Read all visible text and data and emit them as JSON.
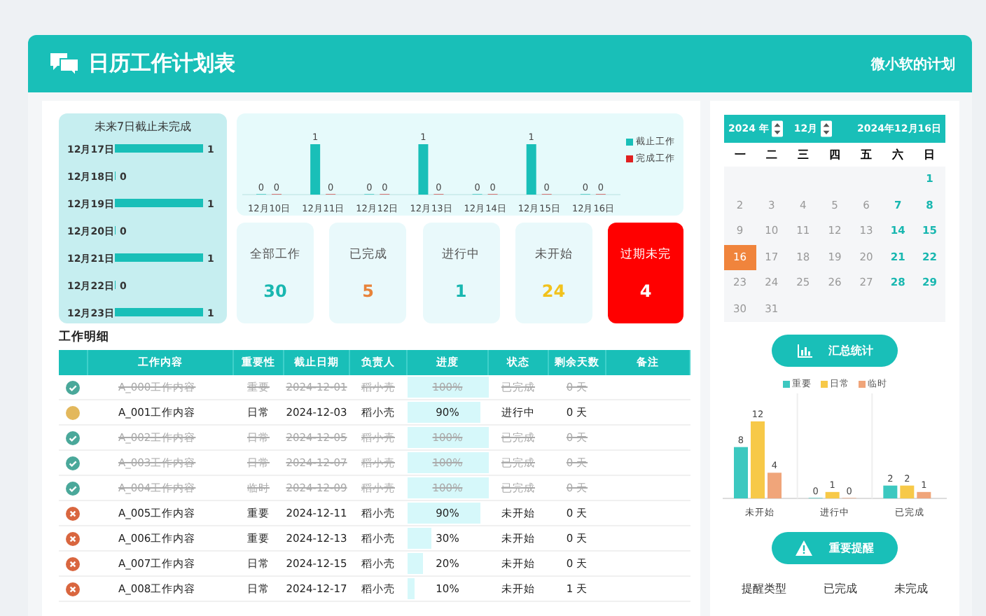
{
  "header": {
    "title": "日历工作计划表",
    "subtitle": "微小软的计划"
  },
  "upcoming": {
    "chart_data": {
      "type": "bar",
      "orientation": "horizontal",
      "title": "未来7日截止未完成",
      "categories": [
        "12月17日",
        "12月18日",
        "12月19日",
        "12月20日",
        "12月21日",
        "12月22日",
        "12月23日"
      ],
      "values": [
        1,
        0,
        1,
        0,
        1,
        0,
        1
      ],
      "data_labels": true
    }
  },
  "week_chart": {
    "chart_data": {
      "type": "bar",
      "categories": [
        "12月10日",
        "12月11日",
        "12月12日",
        "12月13日",
        "12月14日",
        "12月15日",
        "12月16日"
      ],
      "series": [
        {
          "name": "截止工作",
          "color": "#19bfb8",
          "values": [
            0,
            1,
            0,
            1,
            0,
            1,
            0
          ]
        },
        {
          "name": "完成工作",
          "color": "#e02020",
          "values": [
            0,
            0,
            0,
            0,
            0,
            0,
            0
          ]
        }
      ],
      "legend": "right",
      "data_labels": true
    }
  },
  "stats": [
    {
      "kind": "normal",
      "label": "全部工作",
      "value": "30",
      "color": "#19b7b0"
    },
    {
      "kind": "normal",
      "label": "已完成",
      "value": "5",
      "color": "#e8833a"
    },
    {
      "kind": "normal",
      "label": "进行中",
      "value": "1",
      "color": "#19b7b0"
    },
    {
      "kind": "normal",
      "label": "未开始",
      "value": "24",
      "color": "#f2c21b"
    },
    {
      "kind": "alert",
      "label": "过期未完",
      "value": "4",
      "color": "#ffffff"
    }
  ],
  "table": {
    "title": "工作明细",
    "columns": [
      "工作内容",
      "重要性",
      "截止日期",
      "负责人",
      "进度",
      "状态",
      "剩余天数",
      "备注"
    ],
    "rows": [
      {
        "kind": "done",
        "struck": true,
        "content": "A_000工作内容",
        "importance": "重要",
        "deadline": "2024-12-01",
        "owner": "稻小壳",
        "progress": "100%",
        "level": 1,
        "status": "已完成",
        "remaining": "0 天"
      },
      {
        "kind": "progress",
        "struck": false,
        "content": "A_001工作内容",
        "importance": "日常",
        "deadline": "2024-12-03",
        "owner": "稻小壳",
        "progress": "90%",
        "level": 0.9,
        "status": "进行中",
        "remaining": "0 天"
      },
      {
        "kind": "done",
        "struck": true,
        "content": "A_002工作内容",
        "importance": "日常",
        "deadline": "2024-12-05",
        "owner": "稻小壳",
        "progress": "100%",
        "level": 1,
        "status": "已完成",
        "remaining": "0 天"
      },
      {
        "kind": "done",
        "struck": true,
        "content": "A_003工作内容",
        "importance": "日常",
        "deadline": "2024-12-07",
        "owner": "稻小壳",
        "progress": "100%",
        "level": 1,
        "status": "已完成",
        "remaining": "0 天"
      },
      {
        "kind": "done",
        "struck": true,
        "content": "A_004工作内容",
        "importance": "临时",
        "deadline": "2024-12-09",
        "owner": "稻小壳",
        "progress": "100%",
        "level": 1,
        "status": "已完成",
        "remaining": "0 天"
      },
      {
        "kind": "todo",
        "struck": false,
        "content": "A_005工作内容",
        "importance": "重要",
        "deadline": "2024-12-11",
        "owner": "稻小壳",
        "progress": "90%",
        "level": 0.9,
        "status": "未开始",
        "remaining": "0 天"
      },
      {
        "kind": "todo",
        "struck": false,
        "content": "A_006工作内容",
        "importance": "重要",
        "deadline": "2024-12-13",
        "owner": "稻小壳",
        "progress": "30%",
        "level": 0.3,
        "status": "未开始",
        "remaining": "0 天"
      },
      {
        "kind": "todo",
        "struck": false,
        "content": "A_007工作内容",
        "importance": "日常",
        "deadline": "2024-12-15",
        "owner": "稻小壳",
        "progress": "20%",
        "level": 0.2,
        "status": "未开始",
        "remaining": "0 天"
      },
      {
        "kind": "todo",
        "struck": false,
        "content": "A_008工作内容",
        "importance": "日常",
        "deadline": "2024-12-17",
        "owner": "稻小壳",
        "progress": "10%",
        "level": 0.1,
        "status": "未开始",
        "remaining": "1 天"
      }
    ]
  },
  "calendar": {
    "year": "2024 年",
    "month": "12月",
    "date": "2024年12月16日",
    "weekdays": [
      "一",
      "二",
      "三",
      "四",
      "五",
      "六",
      "日"
    ],
    "days": [
      {
        "kind": "blank"
      },
      {
        "kind": "blank"
      },
      {
        "kind": "blank"
      },
      {
        "kind": "blank"
      },
      {
        "kind": "blank"
      },
      {
        "kind": "blank"
      },
      {
        "kind": "day",
        "text": "1",
        "weekend": true,
        "selected": false
      },
      {
        "kind": "day",
        "text": "2",
        "weekend": false,
        "selected": false
      },
      {
        "kind": "day",
        "text": "3",
        "weekend": false,
        "selected": false
      },
      {
        "kind": "day",
        "text": "4",
        "weekend": false,
        "selected": false
      },
      {
        "kind": "day",
        "text": "5",
        "weekend": false,
        "selected": false
      },
      {
        "kind": "day",
        "text": "6",
        "weekend": false,
        "selected": false
      },
      {
        "kind": "day",
        "text": "7",
        "weekend": true,
        "selected": false
      },
      {
        "kind": "day",
        "text": "8",
        "weekend": true,
        "selected": false
      },
      {
        "kind": "day",
        "text": "9",
        "weekend": false,
        "selected": false
      },
      {
        "kind": "day",
        "text": "10",
        "weekend": false,
        "selected": false
      },
      {
        "kind": "day",
        "text": "11",
        "weekend": false,
        "selected": false
      },
      {
        "kind": "day",
        "text": "12",
        "weekend": false,
        "selected": false
      },
      {
        "kind": "day",
        "text": "13",
        "weekend": false,
        "selected": false
      },
      {
        "kind": "day",
        "text": "14",
        "weekend": true,
        "selected": false
      },
      {
        "kind": "day",
        "text": "15",
        "weekend": true,
        "selected": false
      },
      {
        "kind": "day",
        "text": "16",
        "weekend": false,
        "selected": true
      },
      {
        "kind": "day",
        "text": "17",
        "weekend": false,
        "selected": false
      },
      {
        "kind": "day",
        "text": "18",
        "weekend": false,
        "selected": false
      },
      {
        "kind": "day",
        "text": "19",
        "weekend": false,
        "selected": false
      },
      {
        "kind": "day",
        "text": "20",
        "weekend": false,
        "selected": false
      },
      {
        "kind": "day",
        "text": "21",
        "weekend": true,
        "selected": false
      },
      {
        "kind": "day",
        "text": "22",
        "weekend": true,
        "selected": false
      },
      {
        "kind": "day",
        "text": "23",
        "weekend": false,
        "selected": false
      },
      {
        "kind": "day",
        "text": "24",
        "weekend": false,
        "selected": false
      },
      {
        "kind": "day",
        "text": "25",
        "weekend": false,
        "selected": false
      },
      {
        "kind": "day",
        "text": "26",
        "weekend": false,
        "selected": false
      },
      {
        "kind": "day",
        "text": "27",
        "weekend": false,
        "selected": false
      },
      {
        "kind": "day",
        "text": "28",
        "weekend": true,
        "selected": false
      },
      {
        "kind": "day",
        "text": "29",
        "weekend": true,
        "selected": false
      },
      {
        "kind": "day",
        "text": "30",
        "weekend": false,
        "selected": false
      },
      {
        "kind": "day",
        "text": "31",
        "weekend": false,
        "selected": false
      }
    ]
  },
  "summary_button": "汇总统计",
  "summary_chart": {
    "chart_data": {
      "type": "bar",
      "categories": [
        "未开始",
        "进行中",
        "已完成"
      ],
      "series": [
        {
          "name": "重要",
          "color": "#3cc8c0",
          "values": [
            8,
            0,
            2
          ]
        },
        {
          "name": "日常",
          "color": "#f7c948",
          "values": [
            12,
            1,
            2
          ]
        },
        {
          "name": "临时",
          "color": "#f0a57a",
          "values": [
            4,
            0,
            1
          ]
        }
      ],
      "legend": "top",
      "data_labels": true
    }
  },
  "reminder_button": "重要提醒",
  "reminder_columns": [
    "提醒类型",
    "已完成",
    "未完成"
  ]
}
